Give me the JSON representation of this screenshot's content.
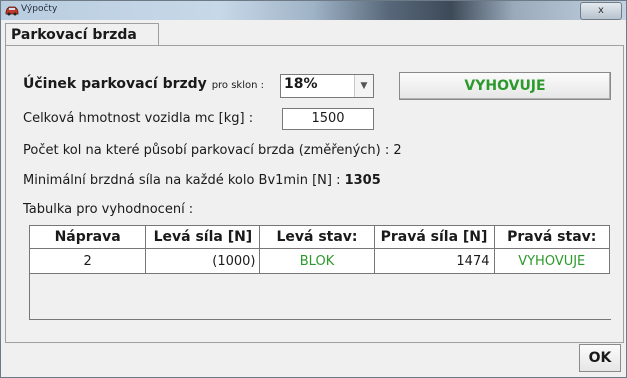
{
  "window": {
    "title": "Výpočty",
    "close_glyph": "x"
  },
  "tab": {
    "label": "Parkovací brzda"
  },
  "effect": {
    "label": "Účinek parkovací brzdy",
    "slope_label": "pro sklon :",
    "slope_value": "18%",
    "status": "VYHOVUJE"
  },
  "mass": {
    "label": "Celková hmotnost vozidla mc [kg] :",
    "value": "1500"
  },
  "wheel_count": {
    "label": "Počet kol na které působí parkovací brzda (změřených) :",
    "value": "2"
  },
  "min_force": {
    "label": "Minimální brzdná síla na každé kolo Bv1min [N] :",
    "value": "1305"
  },
  "table": {
    "caption": "Tabulka pro vyhodnocení :",
    "headers": [
      "Náprava",
      "Levá síla [N]",
      "Levá stav:",
      "Pravá síla [N]",
      "Pravá stav:"
    ],
    "rows": [
      [
        "2",
        "(1000)",
        "BLOK",
        "1474",
        "VYHOVUJE"
      ]
    ]
  },
  "buttons": {
    "ok": "OK"
  },
  "colors": {
    "status_green": "#2d9a2d",
    "window_border": "#6e7a86"
  },
  "icons": {
    "title": "car-icon",
    "close": "close-icon",
    "dropdown": "chevron-down-icon"
  }
}
